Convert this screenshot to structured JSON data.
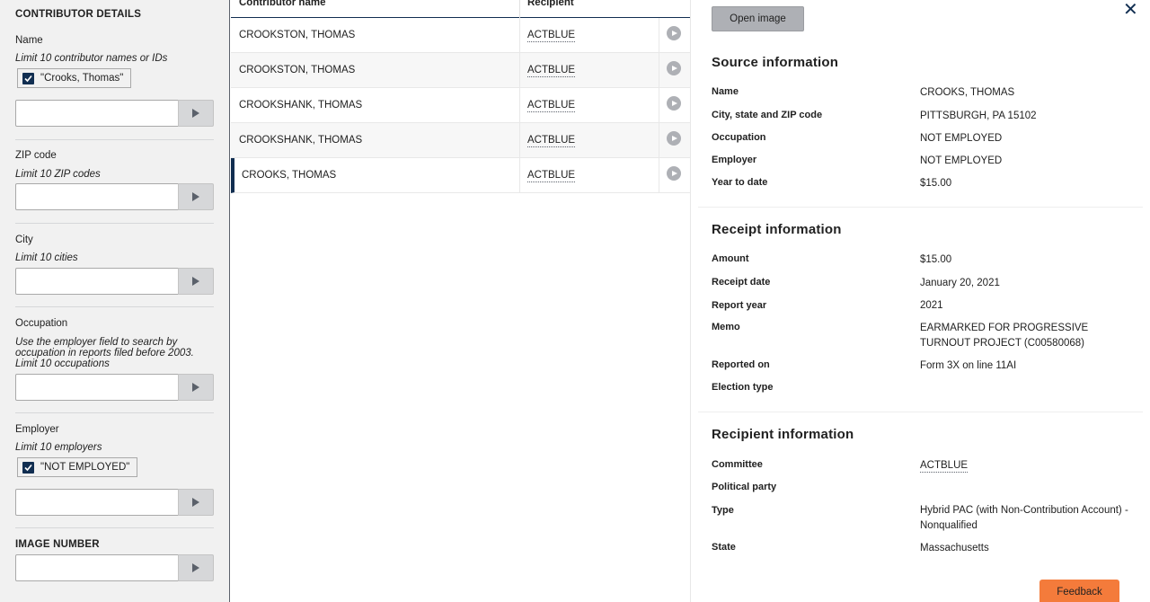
{
  "sidebar": {
    "title": "CONTRIBUTOR DETAILS",
    "name": {
      "label": "Name",
      "hint": "Limit 10 contributor names or IDs",
      "tag": "\"Crooks, Thomas\""
    },
    "zip": {
      "label": "ZIP code",
      "hint": "Limit 10 ZIP codes"
    },
    "city": {
      "label": "City",
      "hint": "Limit 10 cities"
    },
    "occupation": {
      "label": "Occupation",
      "hint": "Use the employer field to search by occupation in reports filed before 2003. Limit 10 occupations"
    },
    "employer": {
      "label": "Employer",
      "hint": "Limit 10 employers",
      "tag": "\"NOT EMPLOYED\""
    },
    "image_number": {
      "label": "IMAGE NUMBER"
    }
  },
  "table": {
    "headers": {
      "name": "Contributor name",
      "recipient": "Recipient"
    },
    "rows": [
      {
        "name": "CROOKSTON, THOMAS",
        "recipient": "ACTBLUE"
      },
      {
        "name": "CROOKSTON, THOMAS",
        "recipient": "ACTBLUE"
      },
      {
        "name": "CROOKSHANK, THOMAS",
        "recipient": "ACTBLUE"
      },
      {
        "name": "CROOKSHANK, THOMAS",
        "recipient": "ACTBLUE"
      },
      {
        "name": "CROOKS, THOMAS",
        "recipient": "ACTBLUE"
      }
    ]
  },
  "panel": {
    "open_image": "Open image",
    "source": {
      "title": "Source information",
      "rows": [
        {
          "k": "Name",
          "v": "CROOKS, THOMAS"
        },
        {
          "k": "City, state and ZIP code",
          "v": "PITTSBURGH, PA 15102"
        },
        {
          "k": "Occupation",
          "v": "NOT EMPLOYED"
        },
        {
          "k": "Employer",
          "v": "NOT EMPLOYED"
        },
        {
          "k": "Year to date",
          "v": "$15.00"
        }
      ]
    },
    "receipt": {
      "title": "Receipt information",
      "rows": [
        {
          "k": "Amount",
          "v": "$15.00"
        },
        {
          "k": "Receipt date",
          "v": "January 20, 2021"
        },
        {
          "k": "Report year",
          "v": "2021"
        },
        {
          "k": "Memo",
          "v": "EARMARKED FOR PROGRESSIVE TURNOUT PROJECT (C00580068)"
        },
        {
          "k": "Reported on",
          "v": "Form 3X on line 11AI"
        },
        {
          "k": "Election type",
          "v": ""
        }
      ]
    },
    "recipient": {
      "title": "Recipient information",
      "rows": [
        {
          "k": "Committee",
          "v": "ACTBLUE"
        },
        {
          "k": "Political party",
          "v": ""
        },
        {
          "k": "Type",
          "v": "Hybrid PAC (with Non-Contribution Account) - Nonqualified"
        },
        {
          "k": "State",
          "v": "Massachusetts"
        }
      ]
    },
    "feedback": "Feedback"
  },
  "colors": {
    "navy": "#112e51",
    "feedback": "#f47b3b",
    "sidebar_bg": "#f1f1f1"
  }
}
